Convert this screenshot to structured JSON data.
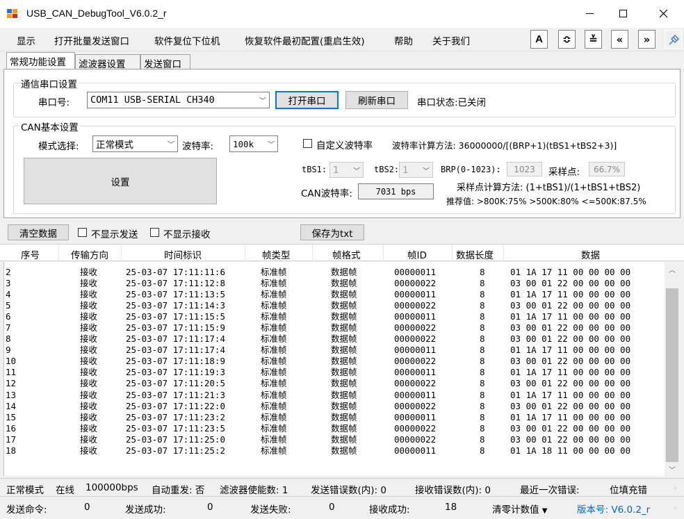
{
  "window": {
    "title": "USB_CAN_DebugTool_V6.0.2_r"
  },
  "menu": [
    "显示",
    "打开批量发送窗口",
    "软件复位下位机",
    "恢复软件最初配置(重启生效)",
    "帮助",
    "关于我们"
  ],
  "toolbar": {
    "font_btn": "A",
    "expand_btn": "≎",
    "collapse_btn": "≚",
    "left_btn": "«",
    "right_btn": "»"
  },
  "tabs": [
    "常规功能设置",
    "滤波器设置",
    "发送窗口"
  ],
  "serial": {
    "group": "通信串口设置",
    "port_label": "串口号:",
    "port_value": "COM11 USB-SERIAL CH340",
    "open_button": "打开串口",
    "refresh_button": "刷新串口",
    "status": "串口状态:已关闭"
  },
  "can": {
    "group": "CAN基本设置",
    "mode_label": "模式选择:",
    "mode_value": "正常模式",
    "baud_label": "波特率:",
    "baud_value": "100k",
    "custom_baud_label": "自定义波特率",
    "baud_formula": "波特率计算方法: 36000000/[(BRP+1)(tBS1+tBS2+3)]",
    "set_button": "设置",
    "tbs1_label": "tBS1:",
    "tbs1_value": "1",
    "tbs2_label": "tBS2:",
    "tbs2_value": "1",
    "brp_label": "BRP(0-1023):",
    "brp_value": "1023",
    "sample_label": "采样点:",
    "sample_value": "66.7%",
    "can_baud_label": "CAN波特率:",
    "can_baud_value": "7031 bps",
    "sample_formula": "采样点计算方法: (1+tBS1)/(1+tBS1+tBS2)",
    "recommend": "推荐值: >800K:75% >500K:80% <=500K:87.5%"
  },
  "list_tools": {
    "clear_button": "清空数据",
    "hide_send": "不显示发送",
    "hide_recv": "不显示接收",
    "save_button": "保存为txt"
  },
  "columns": [
    "序号",
    "传输方向",
    "时间标识",
    "帧类型",
    "帧格式",
    "帧ID",
    "数据长度",
    "数据"
  ],
  "rows": [
    {
      "seq": "2",
      "dir": "接收",
      "time": "25-03-07 17:11:11:6",
      "type": "标准帧",
      "fmt": "数据帧",
      "id": "00000011",
      "len": "8",
      "data": "01 1A 17 11 00 00 00 00"
    },
    {
      "seq": "3",
      "dir": "接收",
      "time": "25-03-07 17:11:12:8",
      "type": "标准帧",
      "fmt": "数据帧",
      "id": "00000022",
      "len": "8",
      "data": "03 00 01 22 00 00 00 00"
    },
    {
      "seq": "4",
      "dir": "接收",
      "time": "25-03-07 17:11:13:5",
      "type": "标准帧",
      "fmt": "数据帧",
      "id": "00000011",
      "len": "8",
      "data": "01 1A 17 11 00 00 00 00"
    },
    {
      "seq": "5",
      "dir": "接收",
      "time": "25-03-07 17:11:14:3",
      "type": "标准帧",
      "fmt": "数据帧",
      "id": "00000022",
      "len": "8",
      "data": "03 00 01 22 00 00 00 00"
    },
    {
      "seq": "6",
      "dir": "接收",
      "time": "25-03-07 17:11:15:5",
      "type": "标准帧",
      "fmt": "数据帧",
      "id": "00000011",
      "len": "8",
      "data": "01 1A 17 11 00 00 00 00"
    },
    {
      "seq": "7",
      "dir": "接收",
      "time": "25-03-07 17:11:15:9",
      "type": "标准帧",
      "fmt": "数据帧",
      "id": "00000022",
      "len": "8",
      "data": "03 00 01 22 00 00 00 00"
    },
    {
      "seq": "8",
      "dir": "接收",
      "time": "25-03-07 17:11:17:4",
      "type": "标准帧",
      "fmt": "数据帧",
      "id": "00000022",
      "len": "8",
      "data": "03 00 01 22 00 00 00 00"
    },
    {
      "seq": "9",
      "dir": "接收",
      "time": "25-03-07 17:11:17:4",
      "type": "标准帧",
      "fmt": "数据帧",
      "id": "00000011",
      "len": "8",
      "data": "01 1A 17 11 00 00 00 00"
    },
    {
      "seq": "10",
      "dir": "接收",
      "time": "25-03-07 17:11:18:9",
      "type": "标准帧",
      "fmt": "数据帧",
      "id": "00000022",
      "len": "8",
      "data": "03 00 01 22 00 00 00 00"
    },
    {
      "seq": "11",
      "dir": "接收",
      "time": "25-03-07 17:11:19:3",
      "type": "标准帧",
      "fmt": "数据帧",
      "id": "00000011",
      "len": "8",
      "data": "01 1A 17 11 00 00 00 00"
    },
    {
      "seq": "12",
      "dir": "接收",
      "time": "25-03-07 17:11:20:5",
      "type": "标准帧",
      "fmt": "数据帧",
      "id": "00000022",
      "len": "8",
      "data": "03 00 01 22 00 00 00 00"
    },
    {
      "seq": "13",
      "dir": "接收",
      "time": "25-03-07 17:11:21:3",
      "type": "标准帧",
      "fmt": "数据帧",
      "id": "00000011",
      "len": "8",
      "data": "01 1A 17 11 00 00 00 00"
    },
    {
      "seq": "14",
      "dir": "接收",
      "time": "25-03-07 17:11:22:0",
      "type": "标准帧",
      "fmt": "数据帧",
      "id": "00000022",
      "len": "8",
      "data": "03 00 01 22 00 00 00 00"
    },
    {
      "seq": "15",
      "dir": "接收",
      "time": "25-03-07 17:11:23:2",
      "type": "标准帧",
      "fmt": "数据帧",
      "id": "00000011",
      "len": "8",
      "data": "01 1A 17 11 00 00 00 00"
    },
    {
      "seq": "16",
      "dir": "接收",
      "time": "25-03-07 17:11:23:5",
      "type": "标准帧",
      "fmt": "数据帧",
      "id": "00000022",
      "len": "8",
      "data": "03 00 01 22 00 00 00 00"
    },
    {
      "seq": "17",
      "dir": "接收",
      "time": "25-03-07 17:11:25:0",
      "type": "标准帧",
      "fmt": "数据帧",
      "id": "00000022",
      "len": "8",
      "data": "03 00 01 22 00 00 00 00"
    },
    {
      "seq": "18",
      "dir": "接收",
      "time": "25-03-07 17:11:25:2",
      "type": "标准帧",
      "fmt": "数据帧",
      "id": "00000011",
      "len": "8",
      "data": "01 1A 18 11 00 00 00 00"
    }
  ],
  "status1": {
    "mode": "正常模式",
    "online": "在线",
    "baud": "100000bps",
    "auto_resend": "自动重发: 否",
    "filter_enable": "滤波器使能数: 1",
    "send_err": "发送错误数(内): 0",
    "recv_err": "接收错误数(内): 0",
    "last_err": "最近一次错误:",
    "last_err_value": "位填充错"
  },
  "status2": {
    "send_cmd_label": "发送命令:",
    "send_cmd": "0",
    "send_ok_label": "发送成功:",
    "send_ok": "0",
    "send_fail_label": "发送失败:",
    "send_fail": "0",
    "recv_ok_label": "接收成功:",
    "recv_ok": "18",
    "clear_counter": "清零计数值",
    "version": "版本号: V6.0.2_r"
  },
  "colors": {
    "accent": "#0078d7",
    "version_link": "#0066cc"
  }
}
